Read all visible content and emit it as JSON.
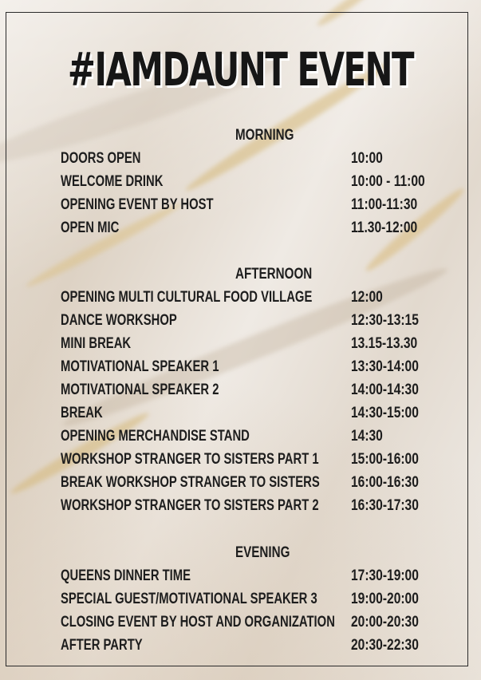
{
  "title": "#IAMDAUNT EVENT",
  "sections": [
    {
      "heading": "MORNING",
      "items": [
        {
          "activity": "DOORS OPEN",
          "time": "10:00"
        },
        {
          "activity": "WELCOME DRINK",
          "time": "10:00 - 11:00"
        },
        {
          "activity": "OPENING EVENT BY HOST",
          "time": "11:00-11:30"
        },
        {
          "activity": "OPEN MIC",
          "time": "11.30-12:00"
        }
      ]
    },
    {
      "heading": "AFTERNOON",
      "items": [
        {
          "activity": "OPENING MULTI CULTURAL FOOD VILLAGE",
          "time": "12:00"
        },
        {
          "activity": "DANCE WORKSHOP",
          "time": "12:30-13:15"
        },
        {
          "activity": "MINI BREAK",
          "time": "13.15-13.30"
        },
        {
          "activity": "MOTIVATIONAL SPEAKER 1",
          "time": "13:30-14:00"
        },
        {
          "activity": "MOTIVATIONAL SPEAKER 2",
          "time": "14:00-14:30"
        },
        {
          "activity": "BREAK",
          "time": "14:30-15:00"
        },
        {
          "activity": "OPENING MERCHANDISE STAND",
          "time": "14:30"
        },
        {
          "activity": "WORKSHOP STRANGER TO SISTERS PART 1",
          "time": "15:00-16:00"
        },
        {
          "activity": "BREAK WORKSHOP STRANGER TO SISTERS",
          "time": "16:00-16:30"
        },
        {
          "activity": "WORKSHOP STRANGER TO SISTERS PART 2",
          "time": "16:30-17:30"
        }
      ]
    },
    {
      "heading": "EVENING",
      "items": [
        {
          "activity": "QUEENS DINNER TIME",
          "time": "17:30-19:00"
        },
        {
          "activity": "SPECIAL GUEST/MOTIVATIONAL SPEAKER 3",
          "time": "19:00-20:00"
        },
        {
          "activity": "CLOSING EVENT BY HOST AND ORGANIZATION",
          "time": "20:00-20:30"
        },
        {
          "activity": "AFTER PARTY",
          "time": "20:30-22:30"
        }
      ]
    }
  ]
}
